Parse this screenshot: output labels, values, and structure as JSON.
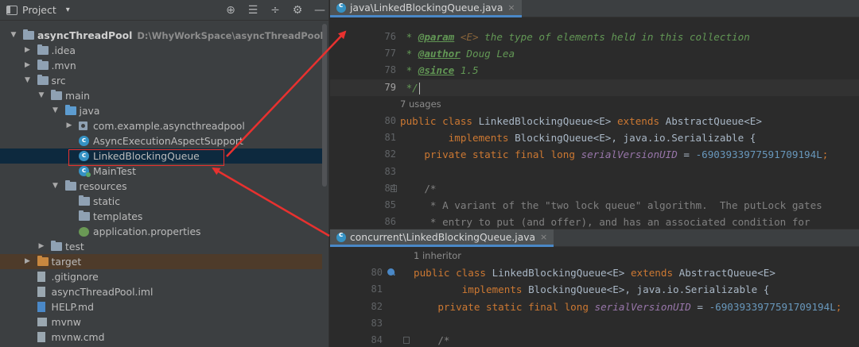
{
  "project_panel": {
    "title": "Project",
    "dropdown_glyph": "▾",
    "tools": [
      "⊕",
      "☰",
      "÷",
      "⚙",
      "—"
    ],
    "tree": [
      {
        "id": "root",
        "label": "asyncThreadPool",
        "hint": "D:\\WhyWorkSpace\\asyncThreadPool",
        "depth": 0,
        "expanded": true,
        "icon": "module-folder-icon",
        "bold": true
      },
      {
        "id": "idea",
        "label": ".idea",
        "depth": 1,
        "expanded": false,
        "icon": "folder-icon"
      },
      {
        "id": "mvn",
        "label": ".mvn",
        "depth": 1,
        "expanded": false,
        "icon": "folder-icon"
      },
      {
        "id": "src",
        "label": "src",
        "depth": 1,
        "expanded": true,
        "icon": "folder-icon"
      },
      {
        "id": "main",
        "label": "main",
        "depth": 2,
        "expanded": true,
        "icon": "folder-icon"
      },
      {
        "id": "java",
        "label": "java",
        "depth": 3,
        "expanded": true,
        "icon": "source-folder-icon"
      },
      {
        "id": "pkg",
        "label": "com.example.asyncthreadpool",
        "depth": 4,
        "expanded": false,
        "icon": "package-icon"
      },
      {
        "id": "aspect",
        "label": "AsyncExecutionAspectSupport",
        "depth": 4,
        "icon": "class-icon"
      },
      {
        "id": "lbq",
        "label": "LinkedBlockingQueue",
        "depth": 4,
        "icon": "class-icon",
        "selected": true
      },
      {
        "id": "maintest",
        "label": "MainTest",
        "depth": 4,
        "icon": "class-runnable-icon"
      },
      {
        "id": "resources",
        "label": "resources",
        "depth": 3,
        "expanded": true,
        "icon": "resources-folder-icon"
      },
      {
        "id": "static",
        "label": "static",
        "depth": 4,
        "icon": "folder-icon"
      },
      {
        "id": "templates",
        "label": "templates",
        "depth": 4,
        "icon": "folder-icon"
      },
      {
        "id": "props",
        "label": "application.properties",
        "depth": 4,
        "icon": "properties-icon"
      },
      {
        "id": "test",
        "label": "test",
        "depth": 2,
        "expanded": false,
        "icon": "folder-icon"
      },
      {
        "id": "target",
        "label": "target",
        "depth": 1,
        "expanded": false,
        "icon": "excluded-folder-icon",
        "highlight": true
      },
      {
        "id": "gitignore",
        "label": ".gitignore",
        "depth": 1,
        "icon": "gitignore-icon"
      },
      {
        "id": "iml",
        "label": "asyncThreadPool.iml",
        "depth": 1,
        "icon": "iml-icon"
      },
      {
        "id": "help",
        "label": "HELP.md",
        "depth": 1,
        "icon": "markdown-icon"
      },
      {
        "id": "mvnw",
        "label": "mvnw",
        "depth": 1,
        "icon": "terminal-file-icon"
      },
      {
        "id": "mvnwcmd",
        "label": "mvnw.cmd",
        "depth": 1,
        "icon": "cmd-file-icon"
      }
    ]
  },
  "editor_top": {
    "tab_label": "java\\LinkedBlockingQueue.java",
    "close_glyph": "×",
    "lines": [
      {
        "n": "76",
        "segs": [
          [
            "doc",
            " * "
          ],
          [
            "doctag",
            "@param"
          ],
          [
            "docp",
            " <E>"
          ],
          [
            "doc",
            " the type of elements held in this collection"
          ]
        ]
      },
      {
        "n": "77",
        "segs": [
          [
            "doc",
            " * "
          ],
          [
            "doctag",
            "@author"
          ],
          [
            "doc",
            " Doug Lea"
          ]
        ]
      },
      {
        "n": "78",
        "segs": [
          [
            "doc",
            " * "
          ],
          [
            "doctag",
            "@since"
          ],
          [
            "doc",
            " 1.5"
          ]
        ]
      },
      {
        "n": "79",
        "current": true,
        "segs": [
          [
            "doc",
            " */"
          ]
        ]
      },
      {
        "hint": "7 usages"
      },
      {
        "n": "80",
        "segs": [
          [
            "kw",
            "public class "
          ],
          [
            "plain",
            "LinkedBlockingQueue<E> "
          ],
          [
            "kw",
            "extends "
          ],
          [
            "plain",
            "AbstractQueue<E>"
          ]
        ]
      },
      {
        "n": "81",
        "segs": [
          [
            "plain",
            "        "
          ],
          [
            "kw",
            "implements "
          ],
          [
            "plain",
            "BlockingQueue<E>, java.io.Serializable {"
          ]
        ]
      },
      {
        "n": "82",
        "segs": [
          [
            "plain",
            "    "
          ],
          [
            "kw",
            "private static final long "
          ],
          [
            "fld",
            "serialVersionUID"
          ],
          [
            "plain",
            " = "
          ],
          [
            "num",
            "-6903933977591709194L"
          ],
          [
            "kw",
            ";"
          ]
        ]
      },
      {
        "n": "83",
        "segs": [
          [
            "plain",
            ""
          ]
        ]
      },
      {
        "n": "84",
        "fold": true,
        "segs": [
          [
            "plain",
            "    "
          ],
          [
            "cm",
            "/*"
          ]
        ]
      },
      {
        "n": "85",
        "segs": [
          [
            "cm",
            "     * A variant of the \"two lock queue\" algorithm.  The putLock gates"
          ]
        ]
      },
      {
        "n": "86",
        "segs": [
          [
            "cm",
            "     * entry to put (and offer), and has an associated condition for"
          ]
        ]
      }
    ]
  },
  "editor_bottom": {
    "tab_label": "concurrent\\LinkedBlockingQueue.java",
    "close_glyph": "×",
    "lines": [
      {
        "hint": "1 inheritor"
      },
      {
        "n": "80",
        "mark": true,
        "segs": [
          [
            "kw",
            "public class "
          ],
          [
            "plain",
            "LinkedBlockingQueue<E> "
          ],
          [
            "kw",
            "extends "
          ],
          [
            "plain",
            "AbstractQueue<E>"
          ]
        ]
      },
      {
        "n": "81",
        "segs": [
          [
            "plain",
            "        "
          ],
          [
            "kw",
            "implements "
          ],
          [
            "plain",
            "BlockingQueue<E>, java.io.Serializable {"
          ]
        ]
      },
      {
        "n": "82",
        "segs": [
          [
            "plain",
            "    "
          ],
          [
            "kw",
            "private static final long "
          ],
          [
            "fld",
            "serialVersionUID"
          ],
          [
            "plain",
            " = "
          ],
          [
            "num",
            "-6903933977591709194L"
          ],
          [
            "kw",
            ";"
          ]
        ]
      },
      {
        "n": "83",
        "segs": [
          [
            "plain",
            ""
          ]
        ]
      },
      {
        "n": "84",
        "fold": true,
        "segs": [
          [
            "plain",
            "    "
          ],
          [
            "cm",
            "/*"
          ]
        ]
      }
    ]
  },
  "colors": {
    "annotation": "#e8312f",
    "selection": "#0d293e",
    "accent": "#4a88c7"
  }
}
